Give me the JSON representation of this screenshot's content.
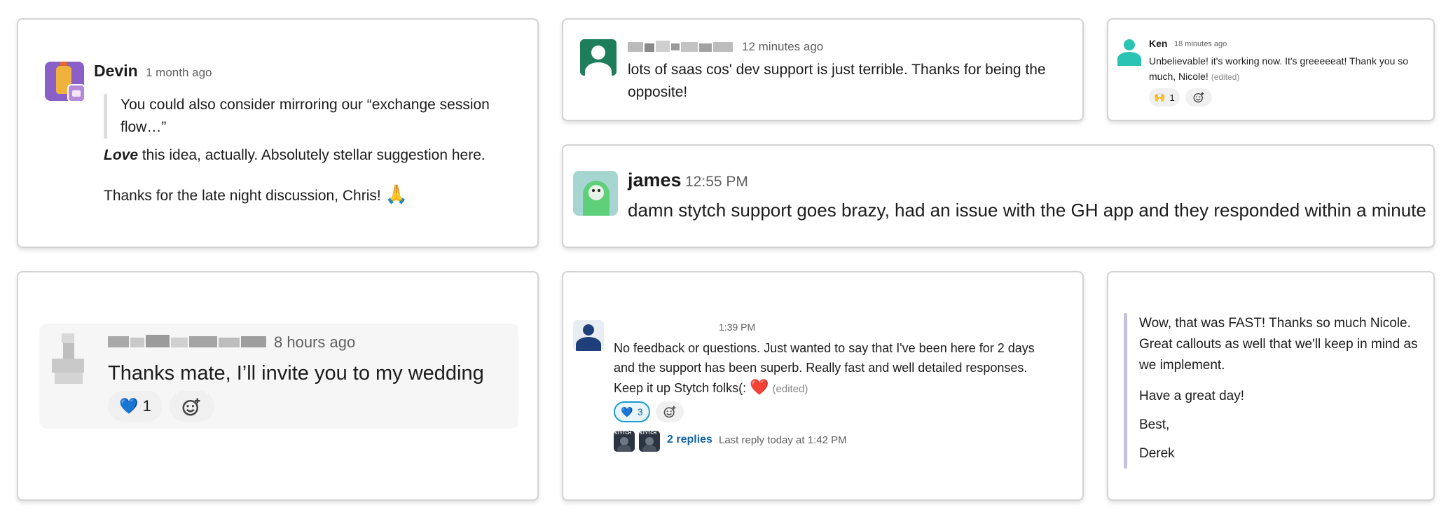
{
  "devin": {
    "name": "Devin",
    "time": "1 month ago",
    "quote": "You could also consider mirroring our “exchange session flow…”",
    "line1_emphasis": "Love",
    "line1_rest": " this idea, actually. Absolutely stellar suggestion here.",
    "line2": "Thanks for the late night discussion, Chris!",
    "line2_emoji": "🙏"
  },
  "saas": {
    "time": "12 minutes ago",
    "message": "lots of saas cos' dev support is just terrible. Thanks for being the opposite!"
  },
  "ken": {
    "name": "Ken",
    "time": "18 minutes ago",
    "message": "Unbelievable! it's working now. It's greeeeeat! Thank you so much, Nicole!",
    "edited": "(edited)",
    "reaction_emoji": "🙌",
    "reaction_count": "1"
  },
  "james": {
    "name": "james",
    "time": "12:55 PM",
    "message": "damn stytch support goes brazy, had an issue with the GH app and they responded within a minute"
  },
  "wedding": {
    "time": "8 hours ago",
    "message": "Thanks mate, I’ll invite you to my wedding",
    "reaction_emoji": "💙",
    "reaction_count": "1"
  },
  "stytch_feedback": {
    "time": "1:39 PM",
    "line1": "No feedback or questions. Just wanted to say that I've been here for 2 days",
    "line2": "and the support has been superb. Really fast and well detailed responses.",
    "line3": "Keep it up Stytch folks(:",
    "line3_emoji": "❤️",
    "edited": "(edited)",
    "reaction_emoji": "💙",
    "reaction_count": "3",
    "replies_label": "2 replies",
    "last_reply": "Last reply today at 1:42 PM",
    "reply_avatar_text": "STYTCH"
  },
  "derek": {
    "para1": "Wow, that was FAST!  Thanks so much Nicole.  Great callouts as well that we'll keep in mind as we implement.",
    "para2": "Have a great day!",
    "para3": "Best,",
    "para4": "Derek"
  },
  "colors": {
    "link_blue": "#1264a3",
    "reaction_active_border": "#1d9bd1",
    "saas_avatar": "#1e7d5a",
    "ken_avatar": "#2bc4b4",
    "stytch_avatar": "#1f3f7a"
  },
  "icons": {
    "add_reaction": "add-reaction-icon",
    "person": "person-icon"
  }
}
